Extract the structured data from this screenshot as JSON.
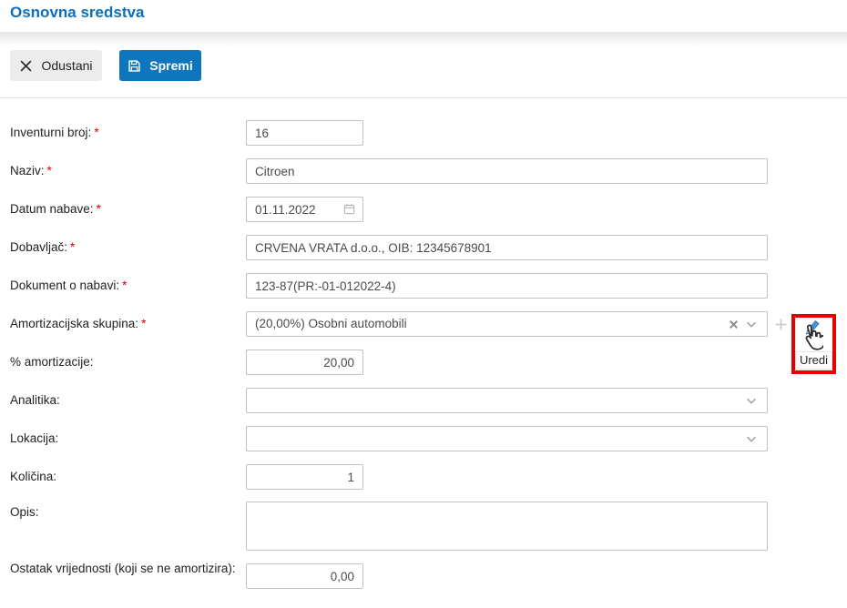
{
  "page_title": "Osnovna sredstva",
  "toolbar": {
    "cancel_label": "Odustani",
    "save_label": "Spremi"
  },
  "marks": {
    "required": "*"
  },
  "colors": {
    "title_blue": "#0d6ebd",
    "save_button_blue": "#0e76bc",
    "cancel_button_gray": "#ececec",
    "highlight_red": "#e60000",
    "required_red": "#d70000",
    "input_border": "#c2c2c2"
  },
  "icons": {
    "cancel": "x-icon",
    "save": "floppy-disk-icon",
    "date": "calendar-icon",
    "select_clear": "x-clear-icon",
    "select_open": "chevron-down-icon",
    "add": "plus-icon",
    "edit": "pencil-icon",
    "cursor": "hand-pointer-icon"
  },
  "fields": {
    "inventurni_broj": {
      "label": "Inventurni broj:",
      "required": true,
      "value": "16"
    },
    "naziv": {
      "label": "Naziv:",
      "required": true,
      "value": "Citroen"
    },
    "datum_nabave": {
      "label": "Datum nabave:",
      "required": true,
      "value": "01.11.2022"
    },
    "dobavljac": {
      "label": "Dobavljač:",
      "required": true,
      "value": "CRVENA VRATA d.o.o., OIB: 12345678901"
    },
    "dokument_o_nabavi": {
      "label": "Dokument o nabavi:",
      "required": true,
      "value": "123-87(PR:-01-012022-4)"
    },
    "amortizacijska_skupina": {
      "label": "Amortizacijska skupina:",
      "required": true,
      "value": "(20,00%) Osobni automobili"
    },
    "postotak_amortizacije": {
      "label": "% amortizacije:",
      "value": "20,00"
    },
    "analitika": {
      "label": "Analitika:",
      "value": ""
    },
    "lokacija": {
      "label": "Lokacija:",
      "value": ""
    },
    "kolicina": {
      "label": "Količina:",
      "value": "1"
    },
    "opis": {
      "label": "Opis:",
      "value": ""
    },
    "ostatak_vrijednosti": {
      "label": "Ostatak vrijednosti (koji se ne amortizira):",
      "value": "0,00"
    }
  },
  "edit_tooltip": "Uredi"
}
